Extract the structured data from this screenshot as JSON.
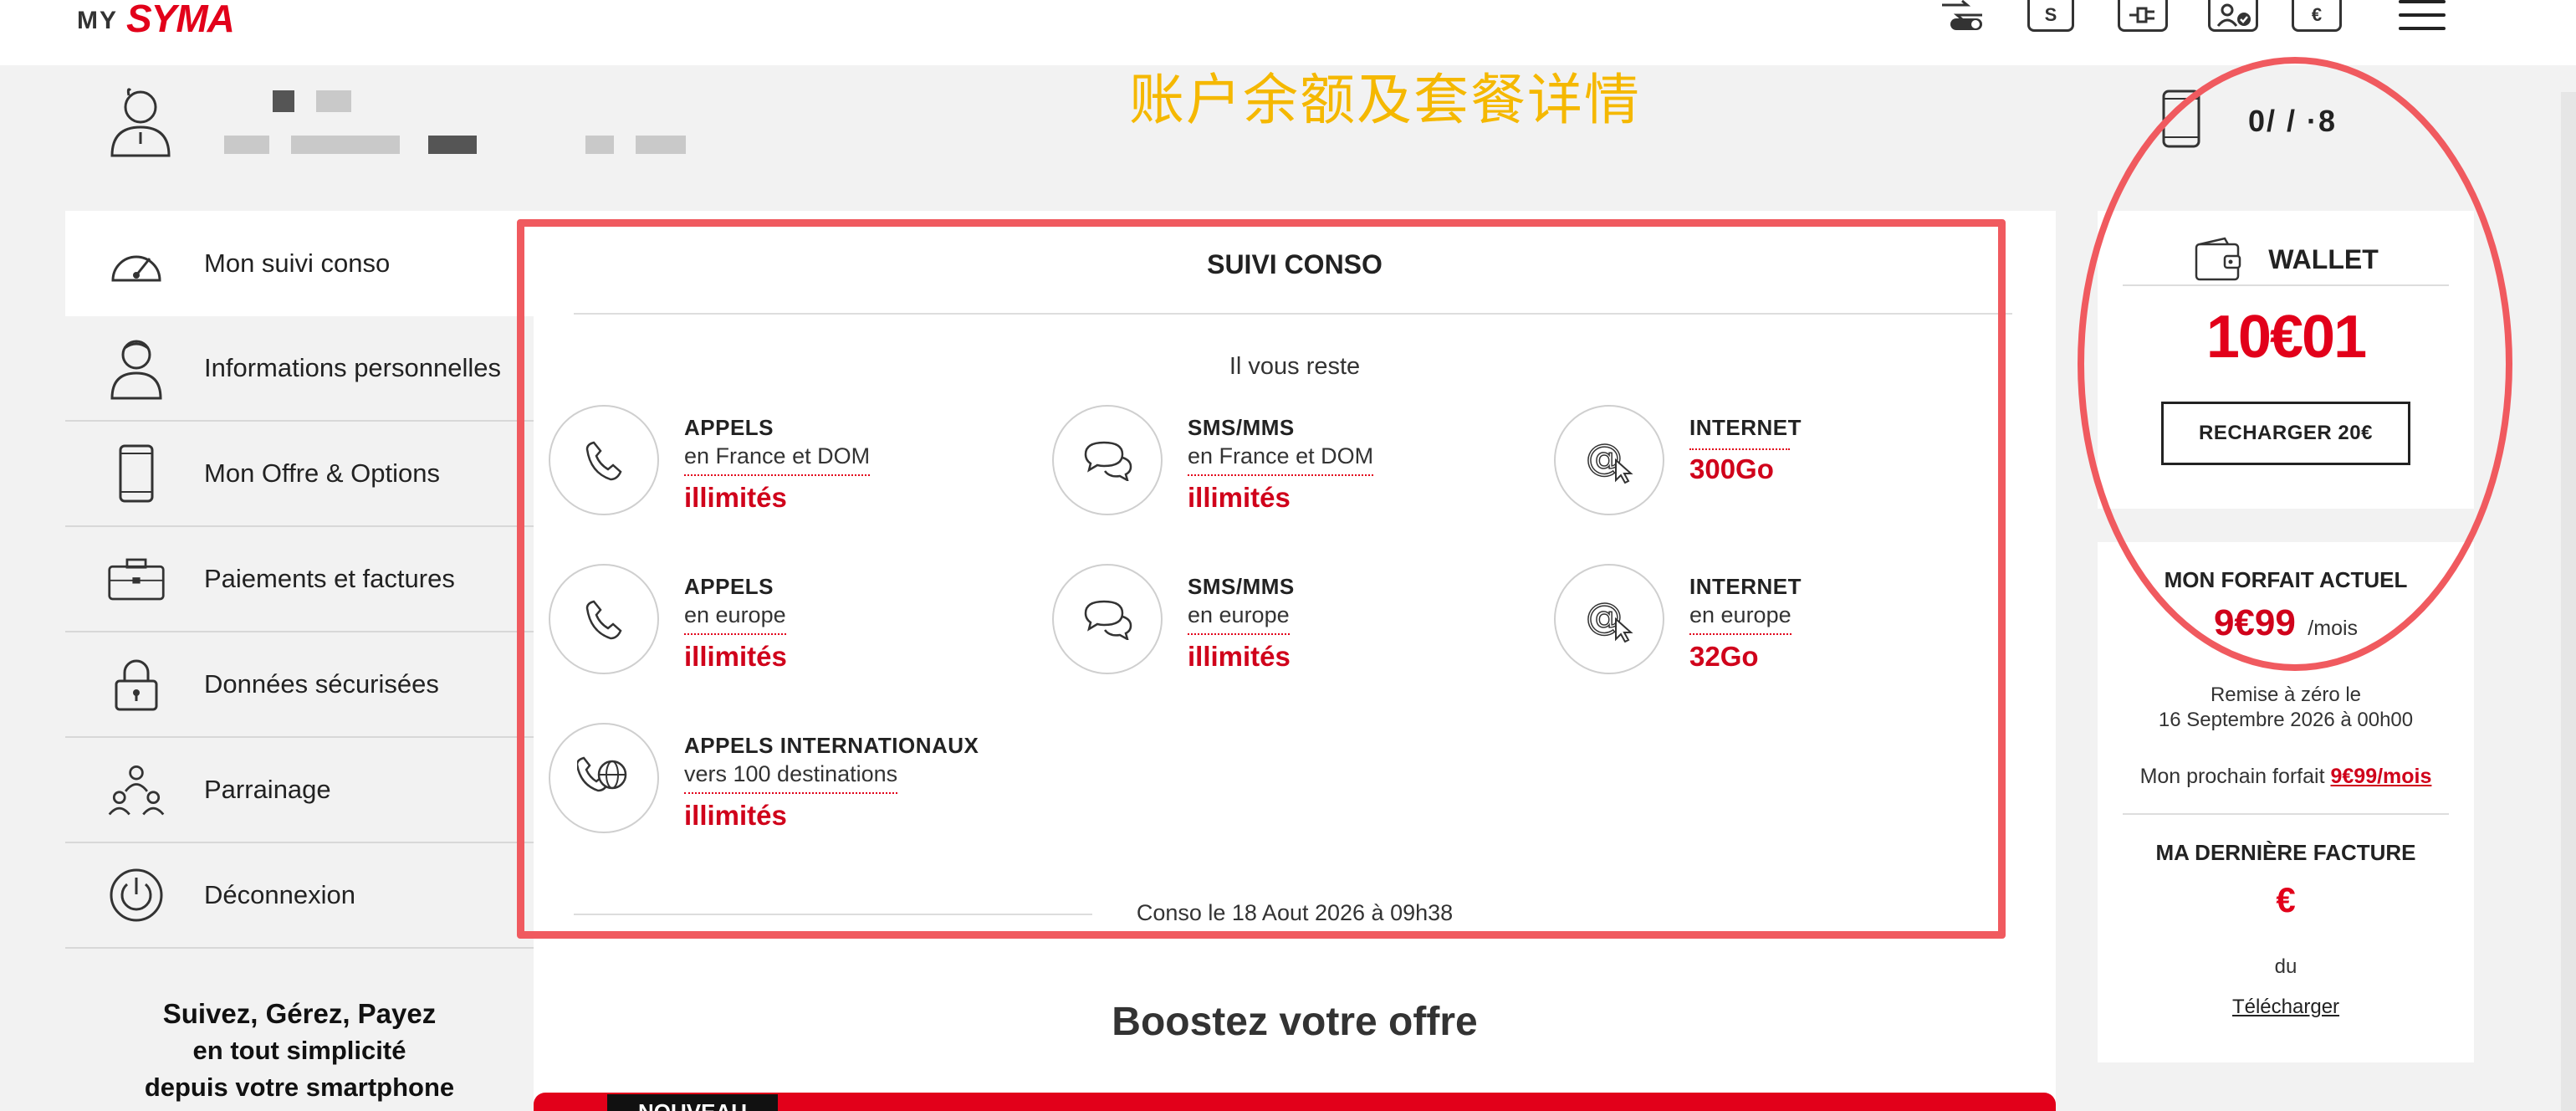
{
  "header": {
    "logo_prefix": "MY",
    "logo_brand": "SYMA",
    "icons": [
      {
        "name": "switch-icon",
        "glyph": ""
      },
      {
        "name": "dollar-icon",
        "glyph": "S"
      },
      {
        "name": "plug-icon",
        "glyph": ""
      },
      {
        "name": "user-check-icon",
        "glyph": ""
      },
      {
        "name": "euro-icon",
        "glyph": "€"
      }
    ],
    "menu_icon": "hamburger-icon"
  },
  "banner_title": "账户余额及套餐详情",
  "user": {
    "phone_number": "0/ /  ·8"
  },
  "sidebar": {
    "items": [
      {
        "label": "Mon suivi conso",
        "icon": "speedometer-icon"
      },
      {
        "label": "Informations personnelles",
        "icon": "user-icon"
      },
      {
        "label": "Mon Offre & Options",
        "icon": "smartphone-icon"
      },
      {
        "label": "Paiements et factures",
        "icon": "briefcase-icon"
      },
      {
        "label": "Données sécurisées",
        "icon": "lock-icon"
      },
      {
        "label": "Parrainage",
        "icon": "group-icon"
      },
      {
        "label": "Déconnexion",
        "icon": "power-icon"
      }
    ],
    "promo": {
      "line1": "Suivez, Gérez, Payez",
      "line2": "en tout simplicité",
      "line3": "depuis votre smartphone"
    }
  },
  "conso": {
    "title": "SUIVI CONSO",
    "remaining": "Il vous reste",
    "tiles": [
      {
        "t1": "APPELS",
        "t2": "en France et DOM",
        "t3": "illimités",
        "icon": "phone-icon"
      },
      {
        "t1": "SMS/MMS",
        "t2": "en France et DOM",
        "t3": "illimités",
        "icon": "chat-icon"
      },
      {
        "t1": "INTERNET",
        "t2": "",
        "t3": "300Go",
        "icon": "at-cursor-icon"
      },
      {
        "t1": "APPELS",
        "t2": "en europe",
        "t3": "illimités",
        "icon": "phone-icon"
      },
      {
        "t1": "SMS/MMS",
        "t2": "en europe",
        "t3": "illimités",
        "icon": "chat-icon"
      },
      {
        "t1": "INTERNET",
        "t2": "en europe",
        "t3": "32Go",
        "icon": "at-cursor-icon"
      },
      {
        "t1": "APPELS INTERNATIONAUX",
        "t2": "vers 100 destinations",
        "t3": "illimités",
        "icon": "globe-phone-icon"
      }
    ],
    "date": "Conso le 18 Aout 2026 à 09h38"
  },
  "boost": {
    "title": "Boostez votre offre",
    "tag": "NOUVEAU"
  },
  "wallet": {
    "title": "WALLET",
    "amount": "10€01",
    "recharge_label": "RECHARGER 20€"
  },
  "forfait": {
    "title": "MON FORFAIT ACTUEL",
    "price": "9€99",
    "unit": "/mois",
    "reset_line1": "Remise à zéro le",
    "reset_line2": "16 Septembre 2026 à 00h00",
    "next_label": "Mon prochain forfait",
    "next_price": "9€99/mois",
    "facture_title": "MA DERNIÈRE FACTURE",
    "facture_amount": "€",
    "facture_du": "du",
    "download": "Télécharger"
  },
  "colors": {
    "brand_red": "#e2001a",
    "highlight_red": "#f05a5f",
    "banner_yellow": "#f5b800",
    "background": "#f2f2f2"
  }
}
